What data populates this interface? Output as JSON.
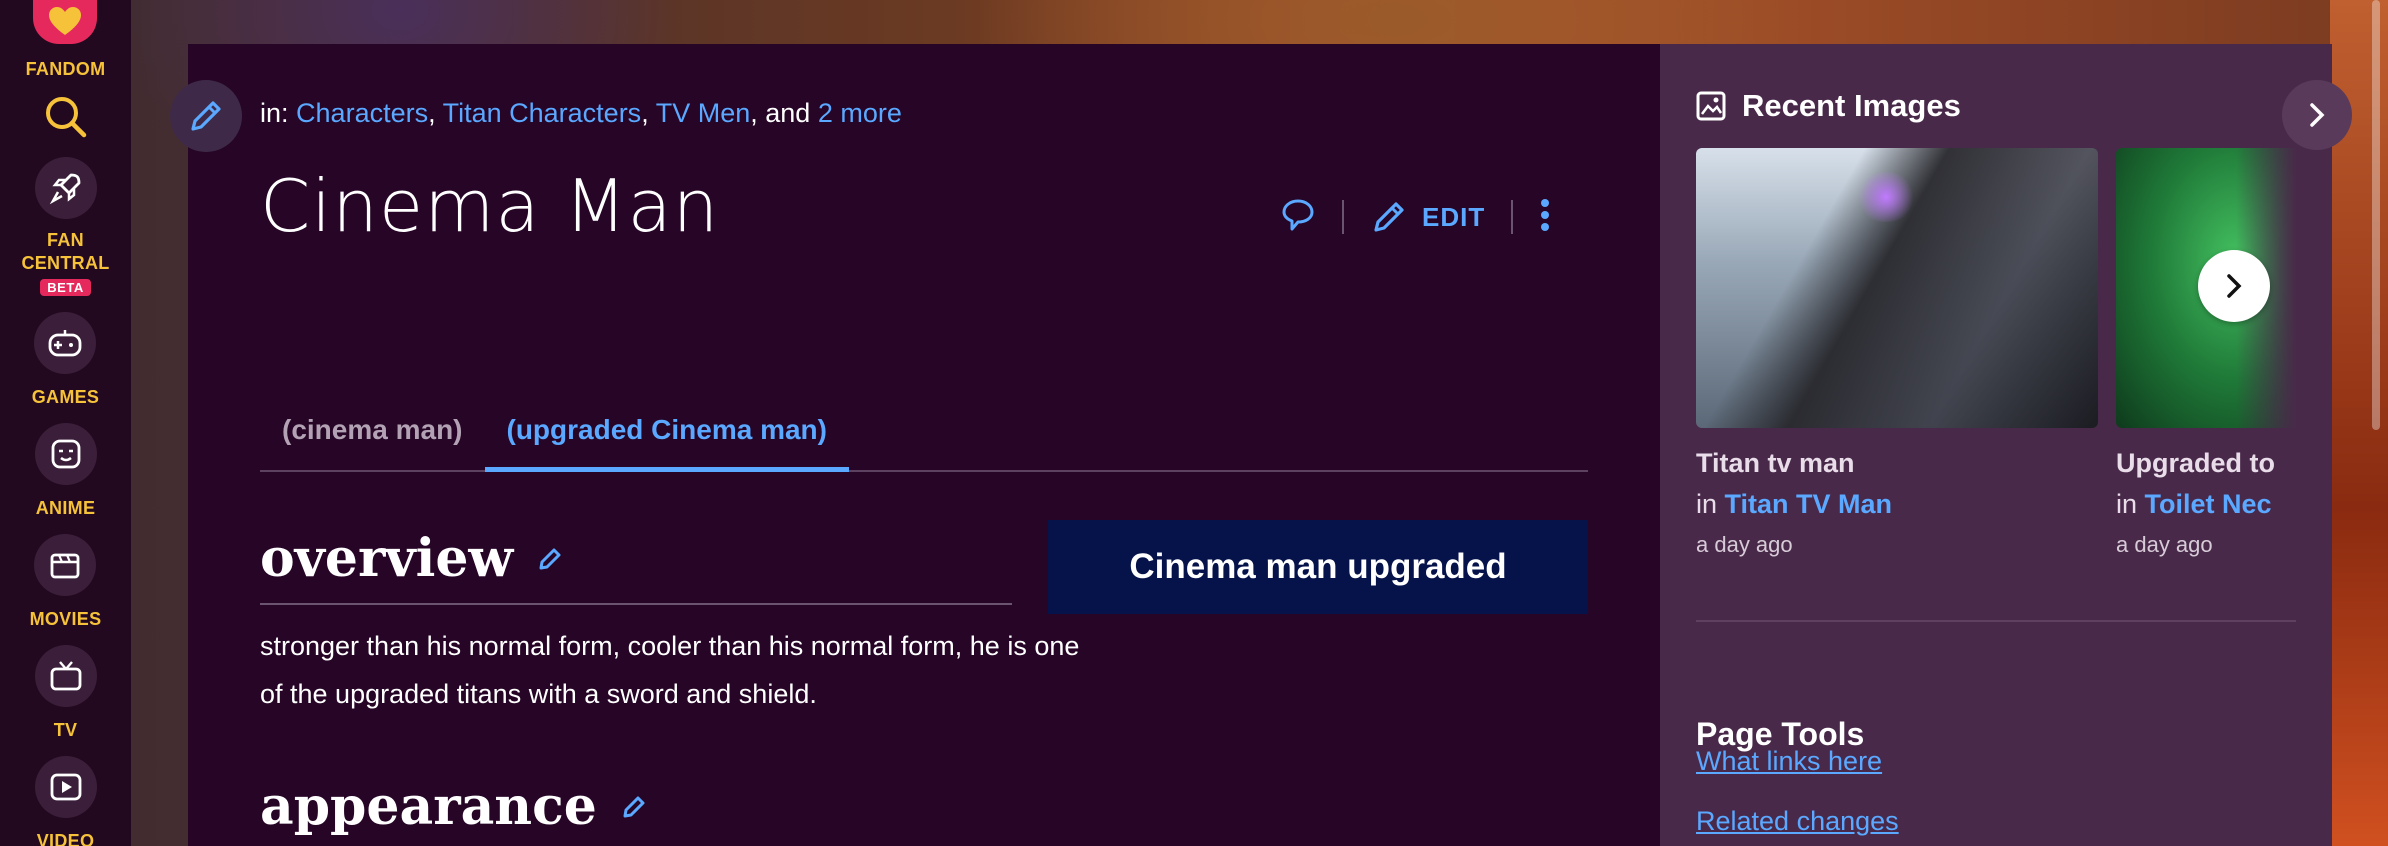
{
  "global_nav": {
    "logo_label": "FANDOM",
    "search_icon": "search-icon",
    "fan_central_label_line1": "FAN",
    "fan_central_label_line2": "CENTRAL",
    "beta_badge": "BETA",
    "games_label": "GAMES",
    "anime_label": "ANIME",
    "movies_label": "MOVIES",
    "tv_label": "TV",
    "video_label": "VIDEO"
  },
  "article": {
    "categories_prefix": "in:",
    "categories": [
      "Characters",
      "Titan Characters",
      "TV Men"
    ],
    "categories_and": "and",
    "categories_more": "2 more",
    "title": "Cinema Man",
    "edit_label": "EDIT",
    "tabs": [
      {
        "label": "(cinema man)",
        "active": false
      },
      {
        "label": "(upgraded Cinema man)",
        "active": true
      }
    ],
    "overview_heading": "overview",
    "infobox_title": "Cinema man upgraded",
    "overview_text": "stronger than his normal form, cooler than his normal form, he is one of the upgraded titans with a sword and shield.",
    "appearance_heading": "appearance"
  },
  "rail": {
    "recent_images_title": "Recent Images",
    "images": [
      {
        "title": "Titan tv man",
        "in_label": "in",
        "in_link": "Titan TV Man",
        "time": "a day ago"
      },
      {
        "title": "Upgraded to",
        "in_label": "in",
        "in_link": "Toilet Nec",
        "time": "a day ago"
      }
    ],
    "page_tools_title": "Page Tools",
    "tool_links": [
      "What links here",
      "Related changes"
    ]
  },
  "colors": {
    "accent": "#5aa8ff",
    "nav_text": "#f5c23a",
    "main_bg": "#260526",
    "rail_bg": "#49294a",
    "infobox_bg": "#06124a",
    "brand_pink": "#e5295d"
  }
}
